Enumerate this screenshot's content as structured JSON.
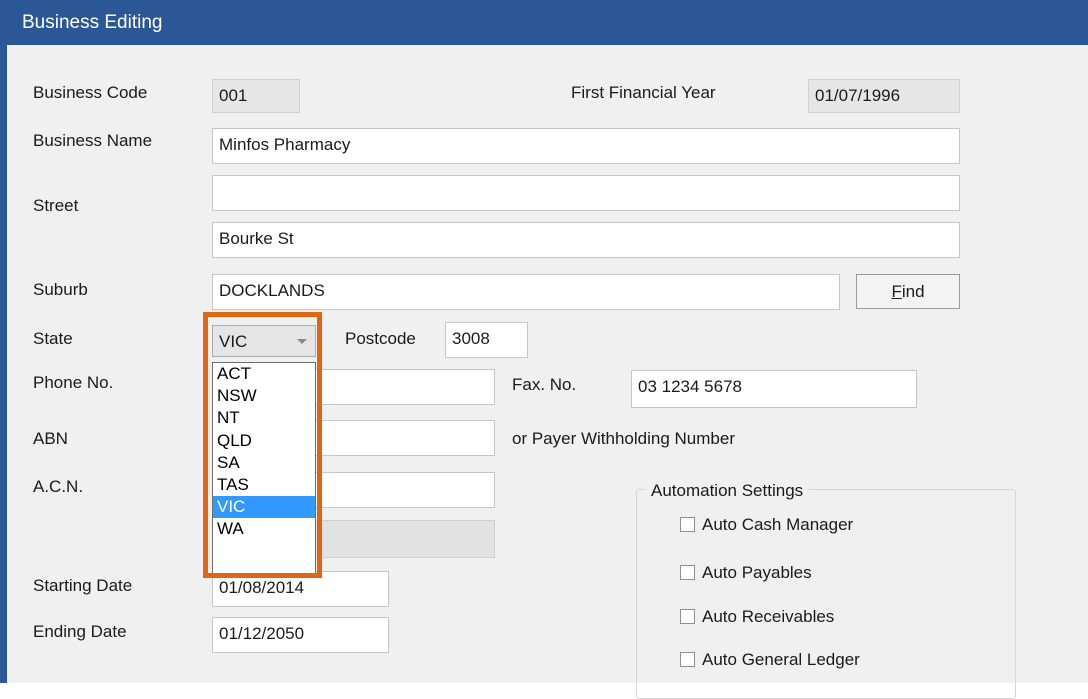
{
  "window": {
    "title": "Business Editing"
  },
  "labels": {
    "business_code": "Business Code",
    "first_financial_year": "First Financial Year",
    "business_name": "Business Name",
    "street": "Street",
    "suburb": "Suburb",
    "state": "State",
    "postcode": "Postcode",
    "phone": "Phone No.",
    "fax": "Fax. No.",
    "abn": "ABN",
    "payer_withholding": "or Payer Withholding Number",
    "acn": "A.C.N.",
    "starting_date": "Starting Date",
    "ending_date": "Ending Date"
  },
  "values": {
    "business_code": "001",
    "first_financial_year": "01/07/1996",
    "business_name": "Minfos Pharmacy",
    "street_line1": "",
    "street_line2": "Bourke St",
    "suburb": "DOCKLANDS",
    "state": "VIC",
    "postcode": "3008",
    "phone": "",
    "fax": "03 1234 5678",
    "abn": "",
    "acn": "",
    "starting_date": "01/08/2014",
    "ending_date": "01/12/2050"
  },
  "buttons": {
    "find_prefix": "",
    "find_mnemonic": "F",
    "find_rest": "ind"
  },
  "state_options": [
    "ACT",
    "NSW",
    "NT",
    "QLD",
    "SA",
    "TAS",
    "VIC",
    "WA"
  ],
  "selected_state_index": 6,
  "automation": {
    "title": "Automation Settings",
    "auto_cash_manager": "Auto Cash Manager",
    "auto_payables": "Auto Payables",
    "auto_receivables": "Auto Receivables",
    "auto_general_ledger": "Auto General Ledger"
  },
  "colors": {
    "titlebar": "#2b5797",
    "highlight": "#e06514",
    "selection": "#3399ff"
  }
}
